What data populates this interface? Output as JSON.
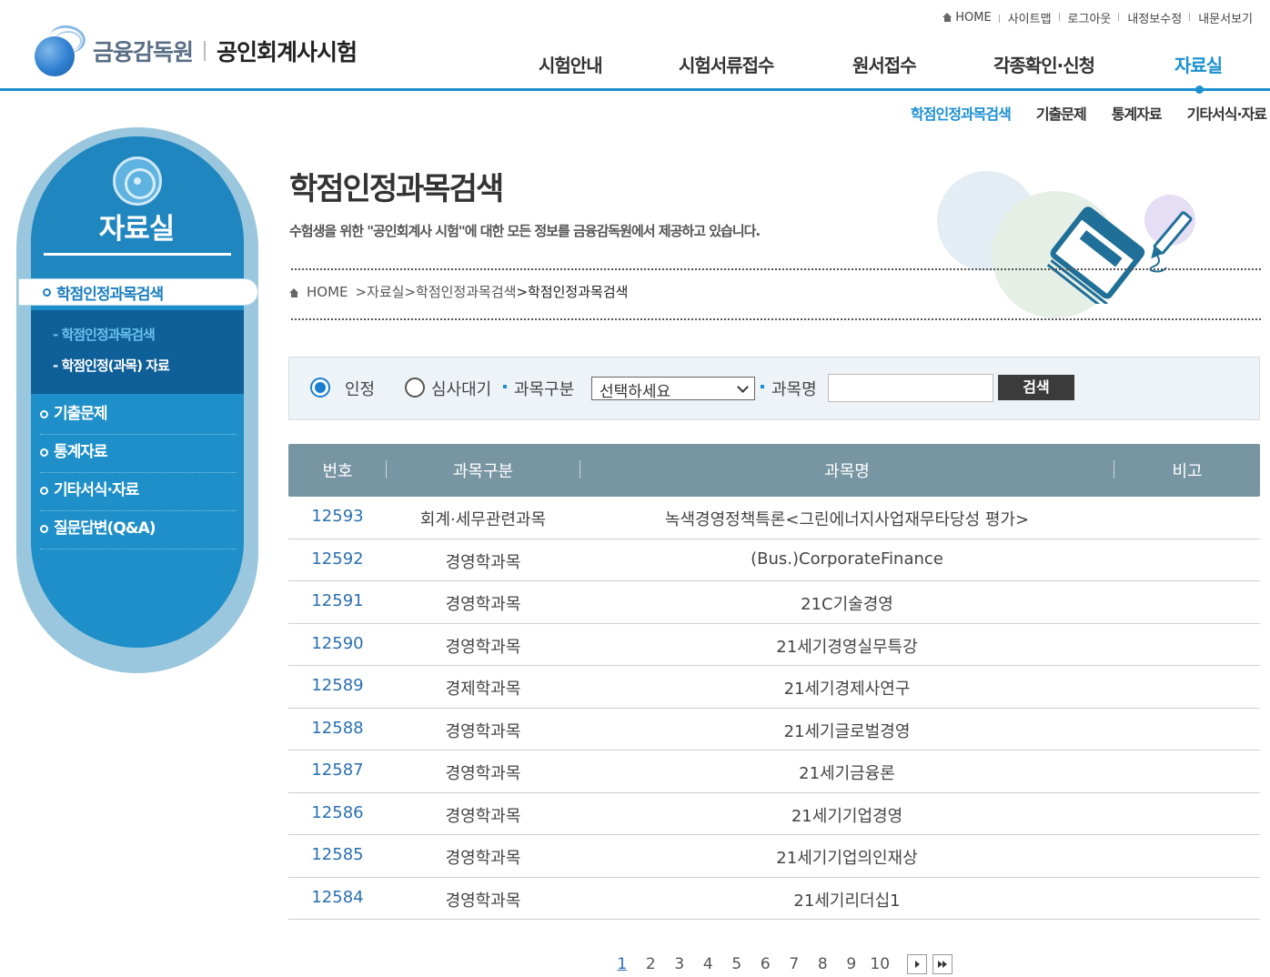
{
  "util_links": [
    "HOME",
    "사이트맵",
    "로그아웃",
    "내정보수정",
    "내문서보기"
  ],
  "logo": {
    "org": "금융감독원",
    "site": "공인회계사시험"
  },
  "gnb": [
    "시험안내",
    "시험서류접수",
    "원서접수",
    "각종확인·신청",
    "자료실"
  ],
  "subnav": [
    "학점인정과목검색",
    "기출문제",
    "통계자료",
    "기타서식·자료"
  ],
  "lnb": {
    "title": "자료실",
    "active": "학점인정과목검색",
    "subs": [
      "- 학점인정과목검색",
      "- 학점인정(과목) 자료"
    ],
    "items": [
      "기출문제",
      "통계자료",
      "기타서식·자료",
      "질문답변(Q&A)"
    ]
  },
  "page": {
    "title": "학점인정과목검색",
    "desc": "수험생을 위한 \"공인회계사 시험\"에 대한 모든 정보를 금융감독원에서 제공하고 있습니다.",
    "breadcrumb": [
      "HOME",
      ">자료실",
      ">학점인정과목검색",
      ">학점인정과목검색"
    ]
  },
  "search": {
    "radio1": "인정",
    "radio2": "심사대기",
    "category_label": "과목구분",
    "category_value": "선택하세요",
    "name_label": "과목명",
    "name_value": "",
    "button": "검색"
  },
  "table": {
    "headers": [
      "번호",
      "과목구분",
      "과목명",
      "비고"
    ],
    "rows": [
      {
        "num": "12593",
        "cat": "회계·세무관련과목",
        "name": "녹색경영정책특론<그린에너지사업재무타당성 평가>"
      },
      {
        "num": "12592",
        "cat": "경영학과목",
        "name": "(Bus.)CorporateFinance"
      },
      {
        "num": "12591",
        "cat": "경영학과목",
        "name": "21C기술경영"
      },
      {
        "num": "12590",
        "cat": "경영학과목",
        "name": "21세기경영실무특강"
      },
      {
        "num": "12589",
        "cat": "경제학과목",
        "name": "21세기경제사연구"
      },
      {
        "num": "12588",
        "cat": "경영학과목",
        "name": "21세기글로벌경영"
      },
      {
        "num": "12587",
        "cat": "경영학과목",
        "name": "21세기금융론"
      },
      {
        "num": "12586",
        "cat": "경영학과목",
        "name": "21세기기업경영"
      },
      {
        "num": "12585",
        "cat": "경영학과목",
        "name": "21세기기업의인재상"
      },
      {
        "num": "12584",
        "cat": "경영학과목",
        "name": "21세기리더십1"
      }
    ]
  },
  "pager": {
    "pages": [
      "1",
      "2",
      "3",
      "4",
      "5",
      "6",
      "7",
      "8",
      "9",
      "10"
    ],
    "current": "1"
  },
  "colors": {
    "accent": "#1a8fd1",
    "header_bar": "#7895a3",
    "link": "#2a6fb0"
  }
}
